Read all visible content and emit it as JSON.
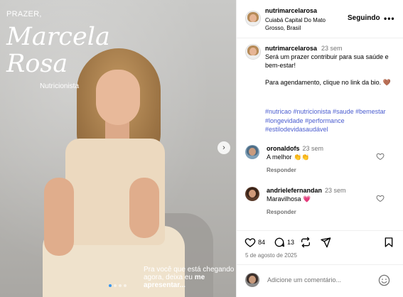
{
  "post": {
    "overlay": {
      "greeting": "PRAZER,",
      "name_line1": "Marcela",
      "name_line2": "Rosa",
      "role": "Nutricionista",
      "cta_text": "Pra você que está chegando agora, deixa eu ",
      "cta_bold": "me apresentar..."
    },
    "carousel_dots": 4,
    "carousel_active": 1
  },
  "header": {
    "username": "nutrimarcelarosa",
    "location": "Cuiabá Capital Do Mato Grosso, Brasil",
    "follow_label": "Seguindo",
    "more_label": "•••"
  },
  "caption": {
    "username": "nutrimarcelarosa",
    "time": "23 sem",
    "text": "Será um prazer contribuir para sua saúde e bem-estar!\n\nPara agendamento, clique no link da bio. 🤎",
    "hashtags": "#nutricao #nutricionista #saude #bemestar #longevidade #performance #estilodevidasaudável"
  },
  "comments": [
    {
      "username": "oronaldofs",
      "time": "23 sem",
      "text": "A melhor 👏👏",
      "reply_label": "Responder"
    },
    {
      "username": "andrielefernandan",
      "time": "23 sem",
      "text": "Maravilhosa 💗",
      "reply_label": "Responder"
    }
  ],
  "actions": {
    "likes": "84",
    "comments": "13",
    "date": "5 de agosto de 2025"
  },
  "add_comment": {
    "placeholder": "Adicione um comentário..."
  },
  "colors": {
    "hashtag": "#4a5ccf",
    "active_dot": "#3897f0",
    "muted": "#737373"
  }
}
